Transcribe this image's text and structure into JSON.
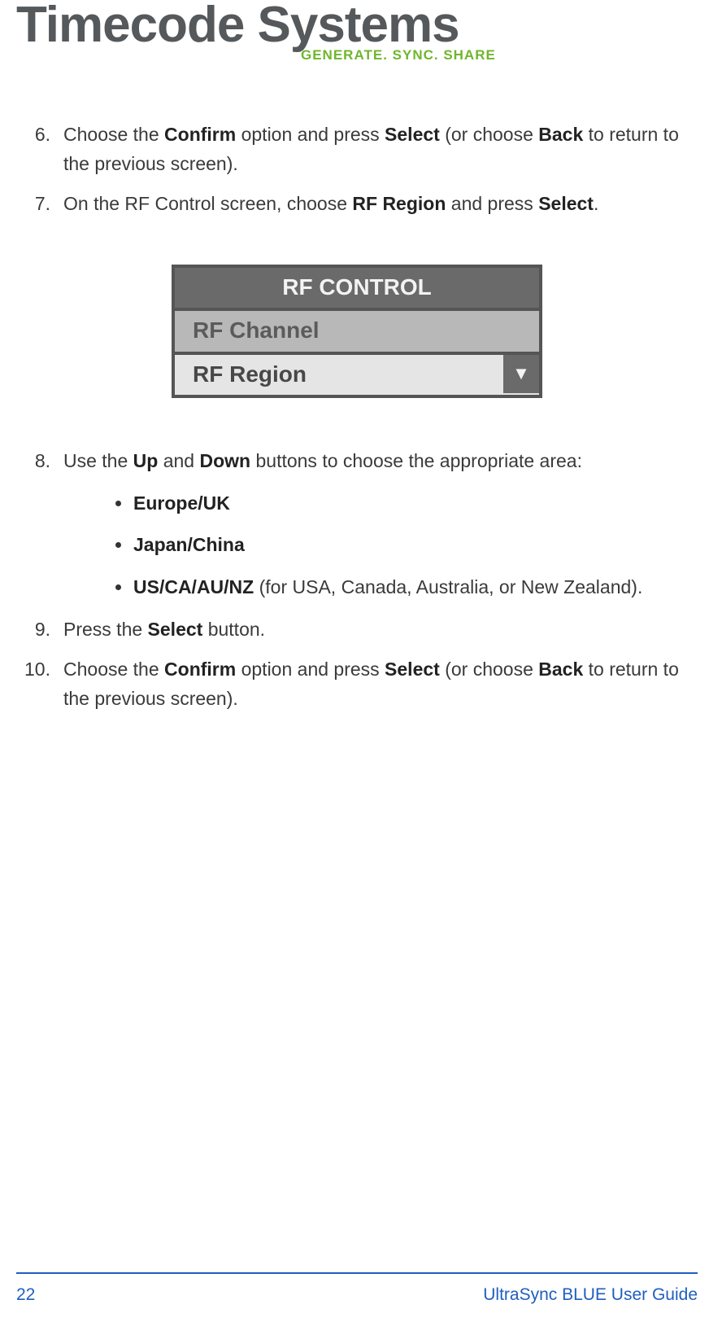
{
  "logo": {
    "main": "Timecode Systems",
    "tagline": "GENERATE. SYNC. SHARE"
  },
  "steps": {
    "s6": {
      "num": "6.",
      "parts": [
        "Choose the ",
        "Confirm",
        " option and press ",
        "Select",
        " (or choose ",
        "Back",
        " to return to the previous screen)."
      ]
    },
    "s7": {
      "num": "7.",
      "parts": [
        "On the RF Control screen, choose ",
        "RF Region",
        " and press ",
        "Select",
        "."
      ]
    },
    "s8": {
      "num": "8.",
      "parts": [
        "Use the ",
        "Up",
        " and ",
        "Down",
        " buttons to choose the appropriate area:"
      ],
      "regions": [
        {
          "bold": "Europe/UK",
          "rest": ""
        },
        {
          "bold": "Japan/China",
          "rest": ""
        },
        {
          "bold": "US/CA/AU/NZ",
          "rest": " (for USA, Canada, Australia, or New Zealand)."
        }
      ]
    },
    "s9": {
      "num": "9.",
      "parts": [
        "Press the ",
        "Select",
        " button."
      ]
    },
    "s10": {
      "num": "10.",
      "parts": [
        "Choose the ",
        "Confirm",
        " option and press ",
        "Select",
        " (or choose ",
        "Back",
        " to return to the previous screen)."
      ]
    }
  },
  "rf_screen": {
    "title": "RF CONTROL",
    "row1": "RF Channel",
    "row2": "RF Region",
    "arrow": "▼"
  },
  "footer": {
    "page": "22",
    "guide": "UltraSync BLUE User Guide"
  }
}
